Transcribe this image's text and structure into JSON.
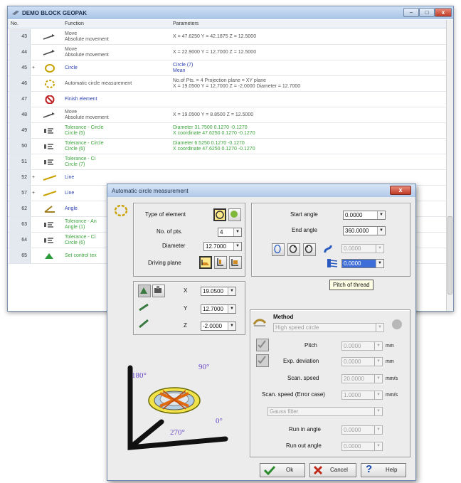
{
  "window": {
    "title": "DEMO BLOCK GEOPAK",
    "columns": {
      "no": "No.",
      "function": "Function",
      "parameters": "Parameters"
    },
    "rows": [
      {
        "no": "43",
        "icon": "move-icon",
        "fn1": "Move",
        "fn2": "Absolute movement",
        "p1": "X = 47.6250  Y = 42.1875  Z = 12.5000",
        "p2": "",
        "color": "gray"
      },
      {
        "no": "44",
        "icon": "move-icon",
        "fn1": "Move",
        "fn2": "Absolute movement",
        "p1": "X = 22.9000  Y = 12.7000  Z = 12.5000",
        "p2": "",
        "color": "gray"
      },
      {
        "no": "45",
        "icon": "circle-icon",
        "fn1": "Circle",
        "fn2": "",
        "p1": "Circle (7)",
        "p2": "Mean",
        "color": "blue"
      },
      {
        "no": "46",
        "icon": "auto-circle-icon",
        "fn1": "Automatic circle measurement",
        "fn2": "",
        "p1": "No.of Pts. = 4  Projection plane = XY plane",
        "p2": "X = 19.0500  Y = 12.7000  Z = -2.0000  Diameter = 12.7000",
        "color": "gray"
      },
      {
        "no": "47",
        "icon": "finish-element-icon",
        "fn1": "Finish element",
        "fn2": "",
        "p1": "",
        "p2": "",
        "color": "blue"
      },
      {
        "no": "48",
        "icon": "move-icon",
        "fn1": "Move",
        "fn2": "Absolute movement",
        "p1": "X = 19.0500  Y = 8.8500  Z = 12.5000",
        "p2": "",
        "color": "gray"
      },
      {
        "no": "49",
        "icon": "tolerance-icon",
        "fn1": "Tolerance - Circle",
        "fn2": "Circle (5)",
        "p1": "Diameter     31.7500       0.1270     -0.1270",
        "p2": "X coordinate    47.6250     0.1270   -0.1270",
        "color": "green"
      },
      {
        "no": "50",
        "icon": "tolerance-icon",
        "fn1": "Tolerance - Circle",
        "fn2": "Circle (6)",
        "p1": "Diameter     6.5250     0.1270     -0.1270",
        "p2": "X coordinate    47.6250     0.1270   -0.1270",
        "color": "green"
      },
      {
        "no": "51",
        "icon": "tolerance-icon",
        "fn1": "Tolerance - Ci",
        "fn2": "Circle (7)",
        "p1": "",
        "p2": "",
        "color": "green"
      },
      {
        "no": "52",
        "icon": "line-icon",
        "fn1": "Line",
        "fn2": "",
        "p1": "",
        "p2": "",
        "color": "blue"
      },
      {
        "no": "57",
        "icon": "line-icon",
        "fn1": "Line",
        "fn2": "",
        "p1": "",
        "p2": "",
        "color": "blue"
      },
      {
        "no": "62",
        "icon": "angle-icon",
        "fn1": "Angle",
        "fn2": "",
        "p1": "",
        "p2": "",
        "color": "blue"
      },
      {
        "no": "63",
        "icon": "tolerance-icon",
        "fn1": "Tolerance - An",
        "fn2": "Angle (1)",
        "p1": "",
        "p2": "",
        "color": "green"
      },
      {
        "no": "64",
        "icon": "tolerance-icon",
        "fn1": "Tolerance - Ci",
        "fn2": "Circle (6)",
        "p1": "",
        "p2": "",
        "color": "green"
      },
      {
        "no": "65",
        "icon": "set-control-icon",
        "fn1": "Set control tex",
        "fn2": "",
        "p1": "",
        "p2": "",
        "color": "green"
      }
    ]
  },
  "dialog": {
    "title": "Automatic circle measurement",
    "type_of_element": "Type of element",
    "no_of_pts_label": "No. of pts.",
    "no_of_pts": "4",
    "diameter_label": "Diameter",
    "diameter": "12.7000",
    "driving_plane": "Driving plane",
    "start_angle_label": "Start angle",
    "start_angle": "0.0000",
    "end_angle_label": "End angle",
    "end_angle": "360.0000",
    "angle_field_dis": "0.0000",
    "angle_field_sel": "0.0000",
    "tooltip": "Pitch of thread",
    "x_label": "X",
    "x": "19.0500",
    "y_label": "Y",
    "y": "12.7000",
    "z_label": "Z",
    "z": "-2.0000",
    "method_label": "Method",
    "method": "High speed circle",
    "pitch_label": "Pitch",
    "pitch": "0.0000",
    "exp_dev_label": "Exp. deviation",
    "exp_dev": "0.0000",
    "scan_speed_label": "Scan. speed",
    "scan_speed": "20.0000",
    "scan_speed_err_label": "Scan. speed (Error case)",
    "scan_speed_err": "1.0000",
    "filter": "Gauss filter",
    "run_in_label": "Run in angle",
    "run_in": "0.0000",
    "run_out_label": "Run out angle",
    "run_out": "0.0000",
    "unit_mm": "mm",
    "unit_mms": "mm/s",
    "deg180": "180°",
    "deg90": "90°",
    "deg0": "0°",
    "deg270": "270°",
    "ok": "Ok",
    "cancel": "Cancel",
    "help": "Help"
  }
}
